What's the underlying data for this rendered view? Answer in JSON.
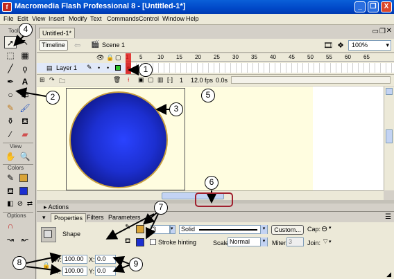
{
  "window": {
    "title": "Macromedia Flash Professional 8 - [Untitled-1*]",
    "buttons": [
      "_",
      "❐",
      "X"
    ]
  },
  "menu": [
    "File",
    "Edit",
    "View",
    "Insert",
    "Modify",
    "Text",
    "Commands",
    "Control",
    "Window",
    "Help"
  ],
  "tools_panel": {
    "header": "Tools",
    "view_label": "View",
    "colors_label": "Colors",
    "options_label": "Options"
  },
  "document": {
    "tab": "Untitled-1*",
    "timeline_button": "Timeline",
    "scene": "Scene 1",
    "zoom": "100%"
  },
  "timeline": {
    "frame_numbers": [
      "1",
      "5",
      "10",
      "15",
      "20",
      "25",
      "30",
      "35",
      "40",
      "45",
      "50",
      "55",
      "60",
      "65"
    ],
    "layer_name": "Layer 1",
    "current_frame": "1",
    "fps": "12.0 fps",
    "time": "0.0s"
  },
  "panels": {
    "actions": "Actions",
    "tabs": [
      "Properties",
      "Filters",
      "Parameters"
    ],
    "shape_label": "Shape",
    "stroke_height": "3",
    "stroke_style": "Solid",
    "custom_button": "Custom...",
    "cap_label": "Cap:",
    "stroke_hinting": "Stroke hinting",
    "scale_label": "Scale:",
    "scale_value": "Normal",
    "miter_label": "Miter:",
    "miter_value": "3",
    "join_label": "Join:",
    "w_label": "W:",
    "w_value": "100.00",
    "h_label": "H:",
    "h_value": "100.00",
    "x_label": "X:",
    "x_value": "0.0",
    "y_label": "Y:",
    "y_value": "0.0"
  },
  "annotations": [
    "1",
    "2",
    "3",
    "4",
    "5",
    "6",
    "7",
    "8",
    "9"
  ],
  "colors": {
    "stroke": "#d9a437",
    "fill": "#1c2fd0",
    "titlebar": "#0048c8",
    "stage": "#fffde0"
  }
}
